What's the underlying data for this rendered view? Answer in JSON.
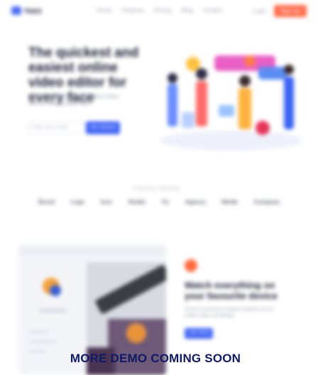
{
  "header": {
    "logo_text": "Appy",
    "nav": [
      "Home",
      "Features",
      "Pricing",
      "Blog",
      "Contact"
    ],
    "login_label": "Login",
    "signup_label": "Sign Up"
  },
  "hero": {
    "title": "The quickest and easiest online video editor for every face",
    "subtitle": "Create, edit and share your videos online with our free and easy editor",
    "input_placeholder": "Enter your email",
    "cta_label": "Get Started"
  },
  "trusted": {
    "label": "Trusted by companies",
    "logos": [
      "Brand",
      "Logo",
      "Icon",
      "Studio",
      "Co",
      "Agency",
      "Media",
      "Company"
    ]
  },
  "feature": {
    "title": "Watch everything on your favourite device",
    "description": "Stream and edit your projects anywhere across mobile, tablet and desktop",
    "button_label": "Learn More"
  },
  "banner": {
    "text": "MORE DEMO COMING SOON"
  },
  "colors": {
    "primary": "#3d63f3",
    "accent": "#ff6b4a",
    "banner_text": "#0e1a66"
  }
}
